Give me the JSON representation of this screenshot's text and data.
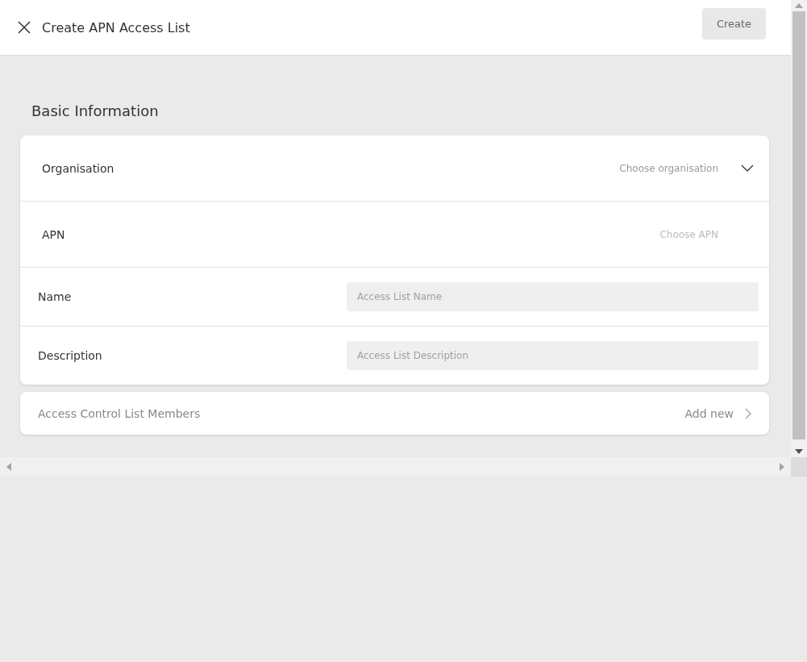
{
  "header": {
    "title": "Create APN Access List",
    "create_button": {
      "label": "Create",
      "disabled": true
    }
  },
  "section": {
    "title": "Basic Information"
  },
  "fields": [
    {
      "kind": "select",
      "label": "Organisation",
      "placeholder": "Choose organisation",
      "disabled": false
    },
    {
      "kind": "select",
      "label": "APN",
      "placeholder": "Choose APN",
      "disabled": true
    },
    {
      "kind": "input",
      "label": "Name",
      "placeholder": "Access List Name"
    },
    {
      "kind": "input",
      "label": "Description",
      "placeholder": "Access List Description"
    }
  ],
  "members": {
    "label": "Access Control List Members",
    "action": "Add new"
  }
}
